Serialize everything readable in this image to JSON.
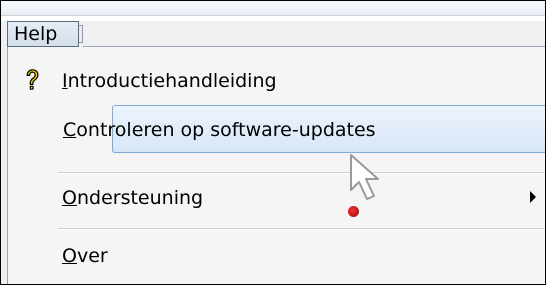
{
  "menu": {
    "title": "Help",
    "items": [
      {
        "id": "introductiehandleiding",
        "label_first": "I",
        "label_rest": "ntroductiehandleiding",
        "icon": "question-mark-icon",
        "state": "normal",
        "has_submenu": false
      },
      {
        "id": "controleren-op-software-updates",
        "label_first": "C",
        "label_rest": "ontroleren op software-updates",
        "icon": null,
        "state": "highlighted",
        "has_submenu": false
      },
      {
        "id": "ondersteuning",
        "label_first": "O",
        "label_rest": "ndersteuning",
        "icon": null,
        "state": "normal",
        "has_submenu": true
      },
      {
        "id": "over",
        "label_first": "O",
        "label_rest": "ver",
        "icon": null,
        "state": "normal",
        "has_submenu": false
      }
    ]
  },
  "colors": {
    "highlight_border": "#80a8d4",
    "highlight_fill": "#d7e6f7",
    "menu_background": "#f5f5f5",
    "click_indicator": "#c40000",
    "help_icon_fill": "#f4d20b"
  },
  "cursor": {
    "icon": "arrow-cursor-icon",
    "click_indicator": "red-click-dot"
  }
}
